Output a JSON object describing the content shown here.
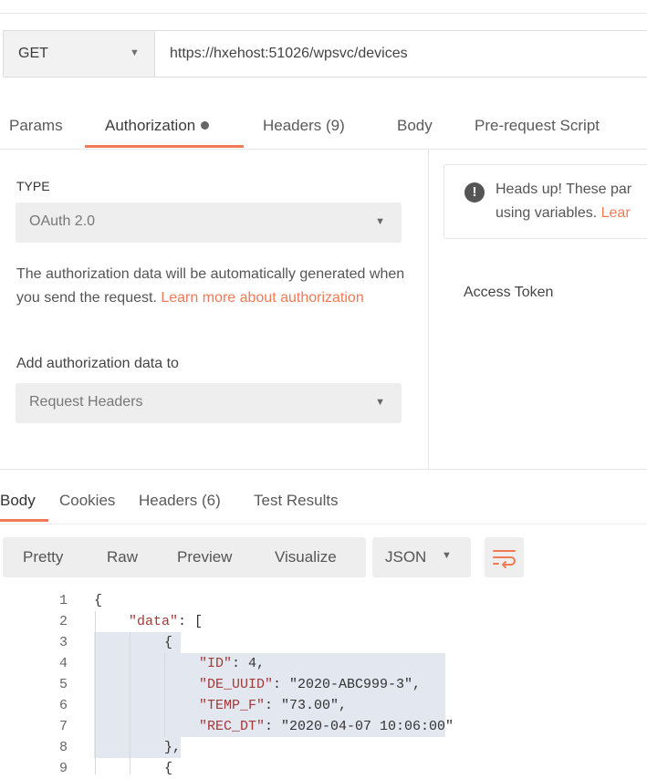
{
  "request": {
    "method": "GET",
    "url": "https://hxehost:51026/wpsvc/devices",
    "tabs": {
      "params": "Params",
      "authorization": "Authorization",
      "headers": "Headers (9)",
      "body": "Body",
      "prerequest": "Pre-request Script"
    }
  },
  "auth": {
    "type_label": "TYPE",
    "type_value": "OAuth 2.0",
    "help_text": "The authorization data will be automatically generated when you send the request.",
    "help_link": "Learn more about authorization",
    "add_label": "Add authorization data to",
    "add_value": "Request Headers"
  },
  "notice": {
    "line1": "Heads up! These par",
    "line2_prefix": "using variables.",
    "line2_link": "Lear"
  },
  "token_label": "Access Token",
  "response": {
    "tabs": {
      "body": "Body",
      "cookies": "Cookies",
      "headers": "Headers (6)",
      "tests": "Test Results"
    },
    "view": {
      "pretty": "Pretty",
      "raw": "Raw",
      "preview": "Preview",
      "visualize": "Visualize",
      "format": "JSON"
    }
  },
  "code_lines": [
    {
      "n": "1",
      "t": "{"
    },
    {
      "n": "2",
      "k": "\"data\"",
      "t": ": ["
    },
    {
      "n": "3",
      "t": "{"
    },
    {
      "n": "4",
      "k": "\"ID\"",
      "t": ": 4,"
    },
    {
      "n": "5",
      "k": "\"DE_UUID\"",
      "t": ": \"2020-ABC999-3\","
    },
    {
      "n": "6",
      "k": "\"TEMP_F\"",
      "t": ": \"73.00\","
    },
    {
      "n": "7",
      "k": "\"REC_DT\"",
      "t": ": \"2020-04-07 10:06:00\""
    },
    {
      "n": "8",
      "t": "},"
    },
    {
      "n": "9",
      "t": "{"
    }
  ],
  "colors": {
    "accent": "#f07a55",
    "code_highlight": "#e3e7ef"
  }
}
